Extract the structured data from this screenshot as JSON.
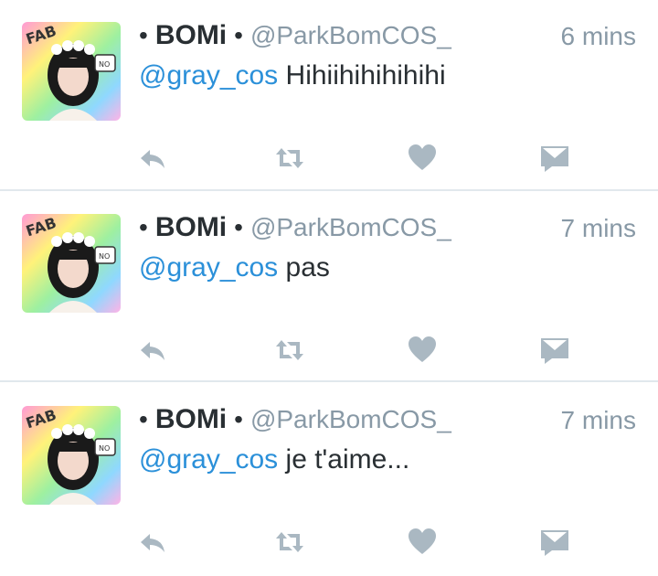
{
  "tweets": [
    {
      "display_name": "BOMi",
      "handle": "@ParkBomCOS_",
      "time": "6 mins",
      "mention": "@gray_cos",
      "text": "Hihiihihihihihi"
    },
    {
      "display_name": "BOMi",
      "handle": "@ParkBomCOS_",
      "time": "7 mins",
      "mention": "@gray_cos",
      "text": "pas"
    },
    {
      "display_name": "BOMi",
      "handle": "@ParkBomCOS_",
      "time": "7 mins",
      "mention": "@gray_cos",
      "text": "je t'aime..."
    }
  ],
  "separator": "•",
  "avatar_label": "FAB",
  "avatar_sign": "NO",
  "icons": {
    "reply": "reply-icon",
    "retweet": "retweet-icon",
    "like": "heart-icon",
    "dm": "direct-message-icon"
  },
  "colors": {
    "name": "#292f33",
    "muted": "#8899a6",
    "mention": "#2b90d9",
    "icon": "#aab8c2",
    "divider": "#e1e8ed"
  }
}
